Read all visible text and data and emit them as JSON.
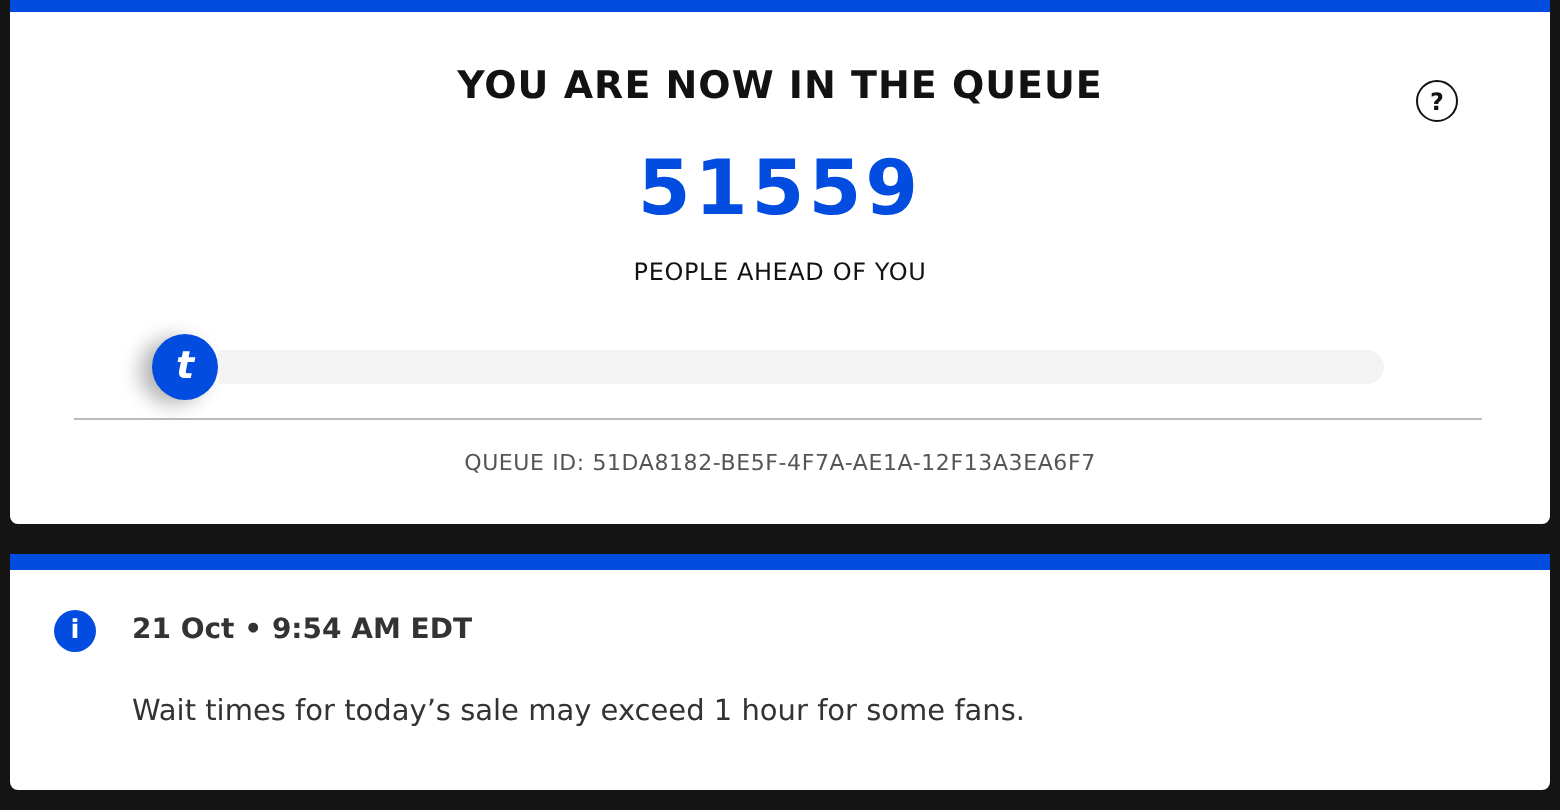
{
  "queue_card": {
    "title": "YOU ARE NOW IN THE QUEUE",
    "help_icon": "?",
    "count": "51559",
    "count_label": "PEOPLE AHEAD OF YOU",
    "progress": {
      "level": 0,
      "thumb_letter": "t"
    },
    "queue_id": "QUEUE ID: 51DA8182-BE5F-4F7A-AE1A-12F13A3EA6F7"
  },
  "notice": {
    "icon": "i",
    "date": "21 Oct • 9:54 AM EDT",
    "message": "Wait times for today’s sale may exceed 1 hour for some fans."
  }
}
